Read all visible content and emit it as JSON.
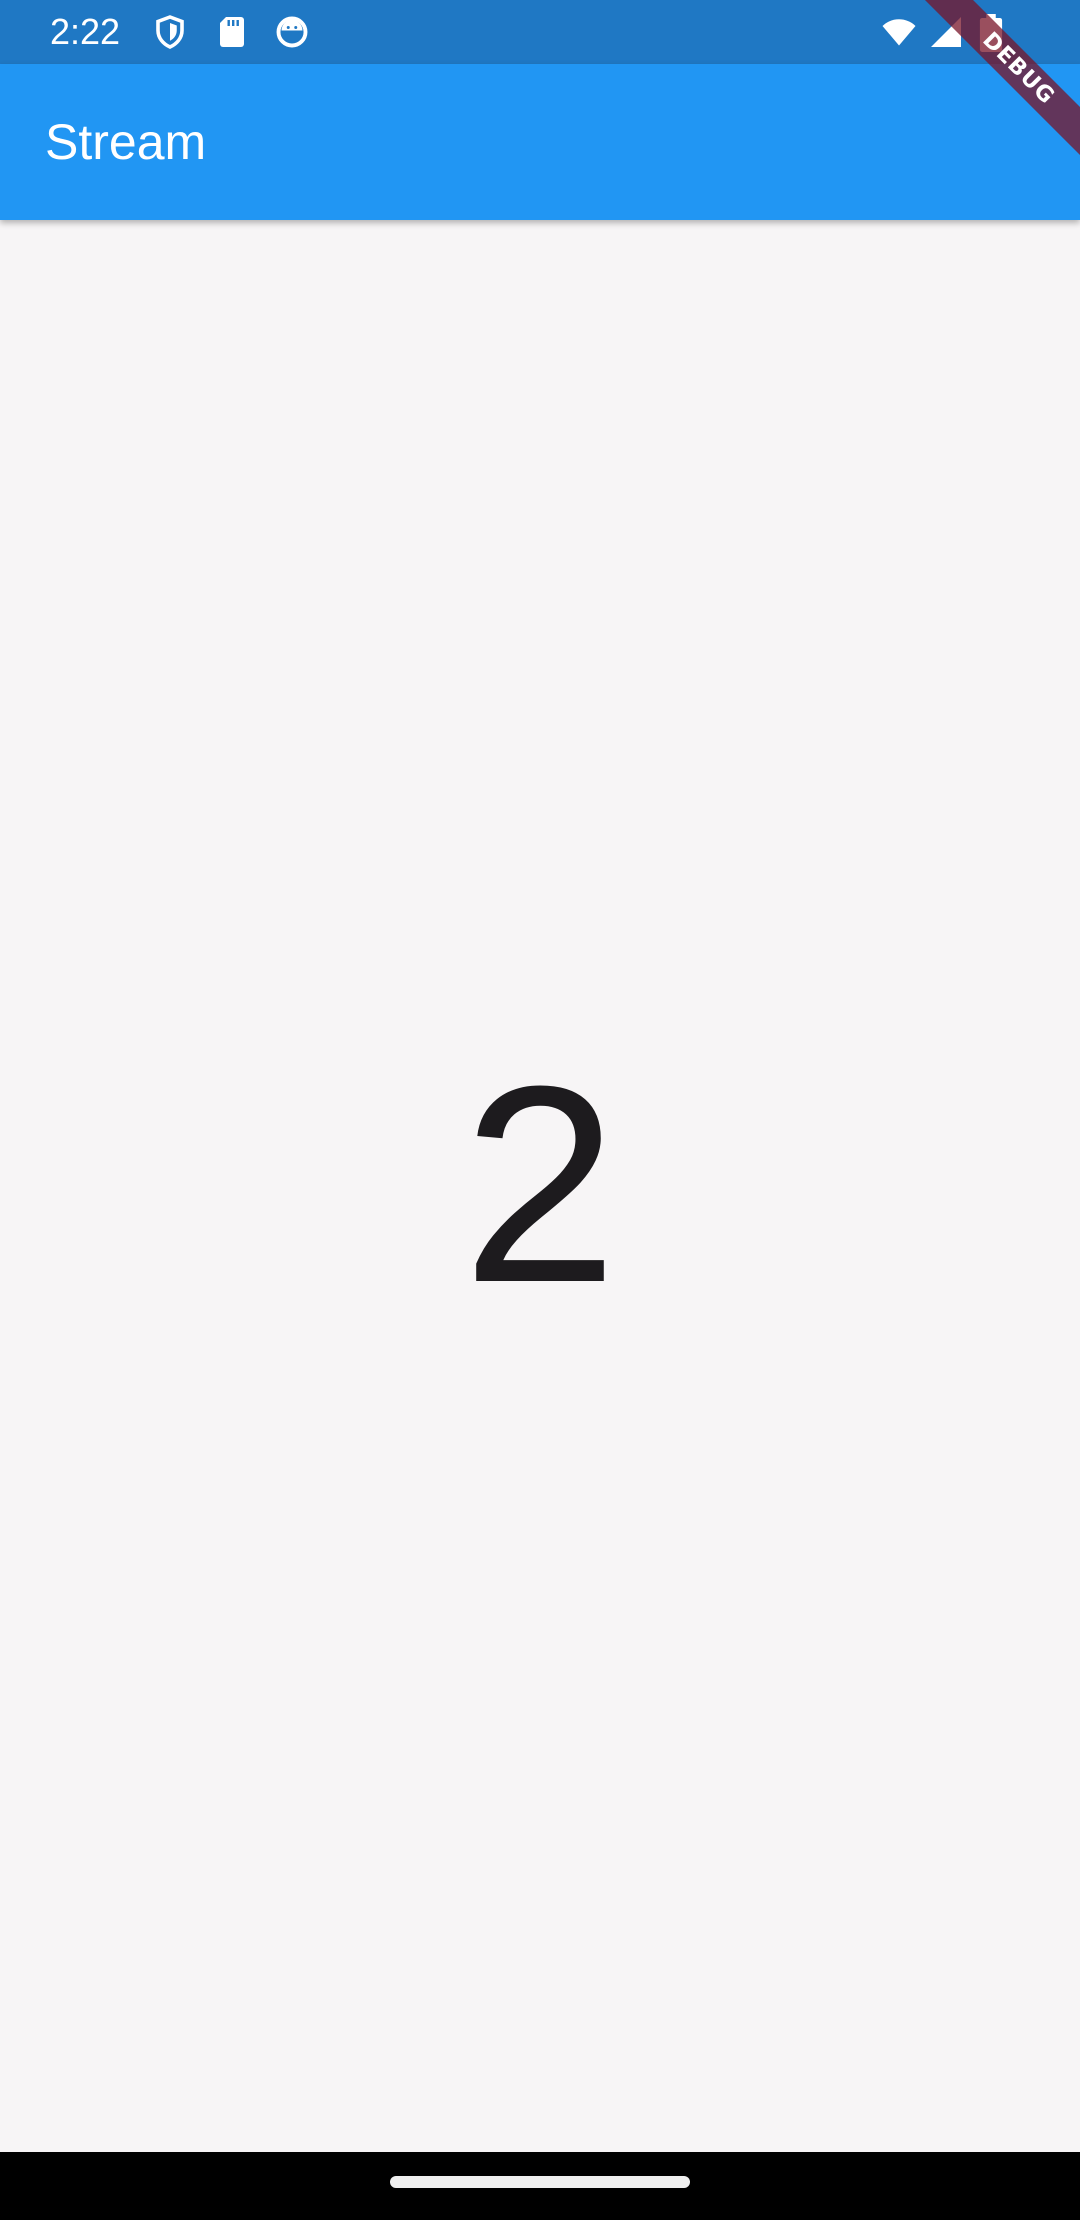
{
  "status_bar": {
    "time": "2:22",
    "left_icons": [
      "shield-icon",
      "sd-card-icon",
      "app-notification-icon"
    ],
    "right_icons": [
      "wifi-icon",
      "cellular-signal-icon",
      "battery-icon"
    ],
    "background": "#1f78c4"
  },
  "app_bar": {
    "title": "Stream",
    "background": "#2196f3"
  },
  "debug_banner": {
    "label": "DEBUG"
  },
  "main": {
    "counter_value": "2"
  },
  "colors": {
    "page_background": "#f7f5f6",
    "text_primary": "#1d1b1e"
  }
}
